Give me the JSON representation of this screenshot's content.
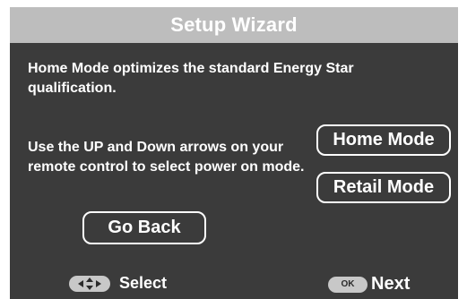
{
  "dialog": {
    "title": "Setup Wizard",
    "description": "Home Mode optimizes the standard Energy Star qualification.",
    "instructions": "Use the UP and Down arrows on your remote control  to select power on mode."
  },
  "options": {
    "home_mode_label": "Home Mode",
    "retail_mode_label": "Retail Mode"
  },
  "actions": {
    "go_back_label": "Go Back"
  },
  "footer": {
    "select_icon": "dpad-arrows-icon",
    "select_label": "Select",
    "next_icon_text": "OK",
    "next_label": "Next"
  },
  "colors": {
    "background": "#3b3b3b",
    "title_bar": "#bdbdbd",
    "text": "#ffffff",
    "button_key": "#c8c8c8"
  }
}
